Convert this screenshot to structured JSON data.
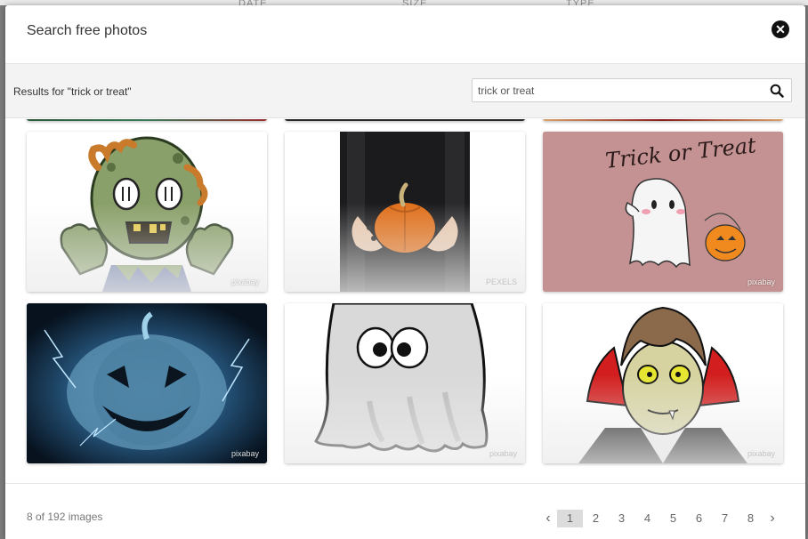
{
  "background": {
    "col_labels": [
      "DATE",
      "SIZE",
      "TYPE"
    ]
  },
  "modal": {
    "title": "Search free photos",
    "close_icon": "close-icon"
  },
  "search": {
    "results_label": "Results for \"trick or treat\"",
    "value": "trick or treat",
    "icon": "search-icon"
  },
  "images": [
    {
      "subject": "zombie cartoon",
      "credit": "pixabay"
    },
    {
      "subject": "hands holding pumpkin",
      "credit": "PEXELS"
    },
    {
      "subject": "ghost trick or treat",
      "caption": "Trick or Treat",
      "credit": "pixabay"
    },
    {
      "subject": "glowing jack-o-lantern",
      "credit": "pixabay"
    },
    {
      "subject": "cartoon ghost",
      "credit": "pixabay"
    },
    {
      "subject": "vampire cartoon",
      "credit": "pixabay"
    }
  ],
  "footer": {
    "count_text": "8 of 192 images",
    "prev_label": "‹",
    "next_label": "›",
    "pages": [
      "1",
      "2",
      "3",
      "4",
      "5",
      "6",
      "7",
      "8"
    ],
    "active_page": "1"
  },
  "colors": {
    "backdrop": "#7b7b7b",
    "modal_bg": "#ffffff",
    "search_bar_bg": "#f3f3f3",
    "active_page_bg": "#dcdcdc"
  }
}
